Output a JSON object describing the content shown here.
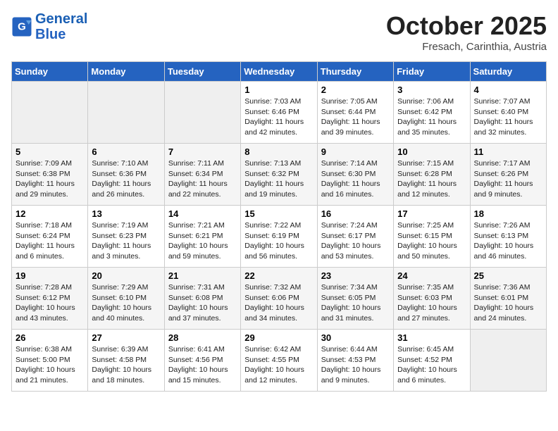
{
  "header": {
    "logo_line1": "General",
    "logo_line2": "Blue",
    "month": "October 2025",
    "location": "Fresach, Carinthia, Austria"
  },
  "weekdays": [
    "Sunday",
    "Monday",
    "Tuesday",
    "Wednesday",
    "Thursday",
    "Friday",
    "Saturday"
  ],
  "weeks": [
    [
      {
        "day": "",
        "info": ""
      },
      {
        "day": "",
        "info": ""
      },
      {
        "day": "",
        "info": ""
      },
      {
        "day": "1",
        "info": "Sunrise: 7:03 AM\nSunset: 6:46 PM\nDaylight: 11 hours\nand 42 minutes."
      },
      {
        "day": "2",
        "info": "Sunrise: 7:05 AM\nSunset: 6:44 PM\nDaylight: 11 hours\nand 39 minutes."
      },
      {
        "day": "3",
        "info": "Sunrise: 7:06 AM\nSunset: 6:42 PM\nDaylight: 11 hours\nand 35 minutes."
      },
      {
        "day": "4",
        "info": "Sunrise: 7:07 AM\nSunset: 6:40 PM\nDaylight: 11 hours\nand 32 minutes."
      }
    ],
    [
      {
        "day": "5",
        "info": "Sunrise: 7:09 AM\nSunset: 6:38 PM\nDaylight: 11 hours\nand 29 minutes."
      },
      {
        "day": "6",
        "info": "Sunrise: 7:10 AM\nSunset: 6:36 PM\nDaylight: 11 hours\nand 26 minutes."
      },
      {
        "day": "7",
        "info": "Sunrise: 7:11 AM\nSunset: 6:34 PM\nDaylight: 11 hours\nand 22 minutes."
      },
      {
        "day": "8",
        "info": "Sunrise: 7:13 AM\nSunset: 6:32 PM\nDaylight: 11 hours\nand 19 minutes."
      },
      {
        "day": "9",
        "info": "Sunrise: 7:14 AM\nSunset: 6:30 PM\nDaylight: 11 hours\nand 16 minutes."
      },
      {
        "day": "10",
        "info": "Sunrise: 7:15 AM\nSunset: 6:28 PM\nDaylight: 11 hours\nand 12 minutes."
      },
      {
        "day": "11",
        "info": "Sunrise: 7:17 AM\nSunset: 6:26 PM\nDaylight: 11 hours\nand 9 minutes."
      }
    ],
    [
      {
        "day": "12",
        "info": "Sunrise: 7:18 AM\nSunset: 6:24 PM\nDaylight: 11 hours\nand 6 minutes."
      },
      {
        "day": "13",
        "info": "Sunrise: 7:19 AM\nSunset: 6:23 PM\nDaylight: 11 hours\nand 3 minutes."
      },
      {
        "day": "14",
        "info": "Sunrise: 7:21 AM\nSunset: 6:21 PM\nDaylight: 10 hours\nand 59 minutes."
      },
      {
        "day": "15",
        "info": "Sunrise: 7:22 AM\nSunset: 6:19 PM\nDaylight: 10 hours\nand 56 minutes."
      },
      {
        "day": "16",
        "info": "Sunrise: 7:24 AM\nSunset: 6:17 PM\nDaylight: 10 hours\nand 53 minutes."
      },
      {
        "day": "17",
        "info": "Sunrise: 7:25 AM\nSunset: 6:15 PM\nDaylight: 10 hours\nand 50 minutes."
      },
      {
        "day": "18",
        "info": "Sunrise: 7:26 AM\nSunset: 6:13 PM\nDaylight: 10 hours\nand 46 minutes."
      }
    ],
    [
      {
        "day": "19",
        "info": "Sunrise: 7:28 AM\nSunset: 6:12 PM\nDaylight: 10 hours\nand 43 minutes."
      },
      {
        "day": "20",
        "info": "Sunrise: 7:29 AM\nSunset: 6:10 PM\nDaylight: 10 hours\nand 40 minutes."
      },
      {
        "day": "21",
        "info": "Sunrise: 7:31 AM\nSunset: 6:08 PM\nDaylight: 10 hours\nand 37 minutes."
      },
      {
        "day": "22",
        "info": "Sunrise: 7:32 AM\nSunset: 6:06 PM\nDaylight: 10 hours\nand 34 minutes."
      },
      {
        "day": "23",
        "info": "Sunrise: 7:34 AM\nSunset: 6:05 PM\nDaylight: 10 hours\nand 31 minutes."
      },
      {
        "day": "24",
        "info": "Sunrise: 7:35 AM\nSunset: 6:03 PM\nDaylight: 10 hours\nand 27 minutes."
      },
      {
        "day": "25",
        "info": "Sunrise: 7:36 AM\nSunset: 6:01 PM\nDaylight: 10 hours\nand 24 minutes."
      }
    ],
    [
      {
        "day": "26",
        "info": "Sunrise: 6:38 AM\nSunset: 5:00 PM\nDaylight: 10 hours\nand 21 minutes."
      },
      {
        "day": "27",
        "info": "Sunrise: 6:39 AM\nSunset: 4:58 PM\nDaylight: 10 hours\nand 18 minutes."
      },
      {
        "day": "28",
        "info": "Sunrise: 6:41 AM\nSunset: 4:56 PM\nDaylight: 10 hours\nand 15 minutes."
      },
      {
        "day": "29",
        "info": "Sunrise: 6:42 AM\nSunset: 4:55 PM\nDaylight: 10 hours\nand 12 minutes."
      },
      {
        "day": "30",
        "info": "Sunrise: 6:44 AM\nSunset: 4:53 PM\nDaylight: 10 hours\nand 9 minutes."
      },
      {
        "day": "31",
        "info": "Sunrise: 6:45 AM\nSunset: 4:52 PM\nDaylight: 10 hours\nand 6 minutes."
      },
      {
        "day": "",
        "info": ""
      }
    ]
  ]
}
